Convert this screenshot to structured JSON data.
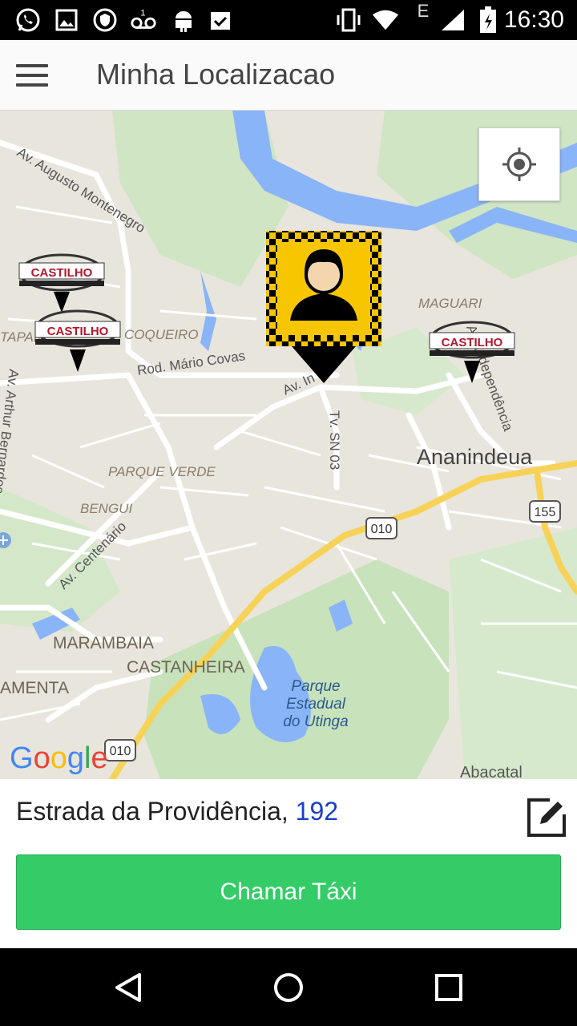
{
  "status_bar": {
    "time": "16:30",
    "network_type": "E",
    "icons": [
      "whatsapp-icon",
      "image-icon",
      "vpn-shield-icon",
      "voicemail-icon",
      "android-icon",
      "clipboard-check-icon",
      "vibrate-icon",
      "wifi-icon",
      "signal-icon",
      "battery-icon"
    ]
  },
  "app_bar": {
    "title": "Minha Localizacao",
    "menu_icon": "hamburger-menu-icon"
  },
  "map": {
    "locate_icon": "my-location-icon",
    "logo": "Google",
    "marker_label": "CASTILHO",
    "place_labels": {
      "av_augusto_montenegro": "Av. Augusto Montenegro",
      "tapan": "TAPAN",
      "coqueiro": "COQUEIRO",
      "rod_mario_covas": "Rod. Mário Covas",
      "av_in": "Av. In",
      "maguari": "MAGUARI",
      "av_independencia": "Av. Independência",
      "tv_sn03": "Tv. SN 03",
      "ananindeua": "Ananindeua",
      "parque_verde": "PARQUE VERDE",
      "bengui": "BENGUI",
      "av_centenario": "Av. Centenário",
      "arthur_bernardes": "Av. Arthur Bernardes",
      "marambaia": "MARAMBAIA",
      "castanheira": "CASTANHEIRA",
      "amenta": "AMENTA",
      "parque_line1": "Parque",
      "parque_line2": "Estadual",
      "parque_line3": "do Utinga",
      "abacatal": "Abacatal",
      "shield_010": "010",
      "shield_155": "155"
    }
  },
  "address": {
    "street": "Estrada da Providência,",
    "number": "192",
    "edit_icon": "edit-icon"
  },
  "actions": {
    "call_taxi": "Chamar Táxi"
  },
  "nav_bar": {
    "back_icon": "back-triangle-icon",
    "home_icon": "home-circle-icon",
    "recents_icon": "recents-square-icon"
  },
  "colors": {
    "call_button": "#33cc66",
    "address_number": "#1a3fcc",
    "map_background": "#e8e5dd",
    "water": "#8ab4f8",
    "highway": "#f6d358",
    "marker_yellow": "#f7c600"
  }
}
